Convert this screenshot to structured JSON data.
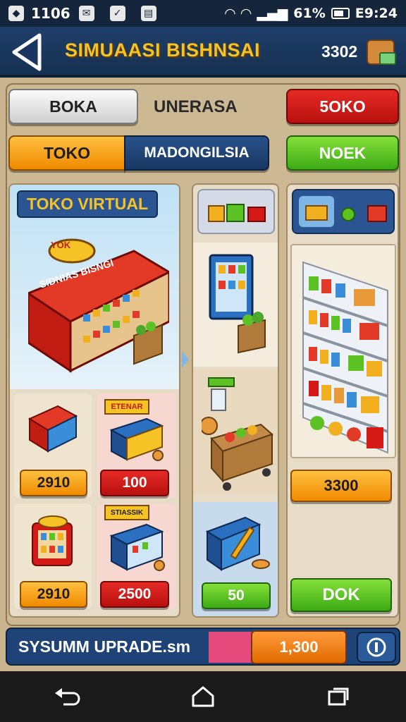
{
  "status_bar": {
    "left_text": "1106",
    "battery_percent": "61%",
    "time": "E9:24"
  },
  "header": {
    "title": "SIMUAASI BISHNSAI",
    "coins": "3302"
  },
  "tabs_row1": {
    "left": "BOKA",
    "middle": "UNERASA",
    "right": "5OKO"
  },
  "tabs_row2": {
    "left": "TOKO",
    "middle": "MADONGILSIA",
    "right": "NOEK"
  },
  "left_column": {
    "title": "TOKO VIRTUAL",
    "store_badge": "YOK",
    "store_sign": "SIDNIAS BISNGI",
    "cards": [
      {
        "sign": "",
        "price": "2910",
        "color": "orange"
      },
      {
        "sign": "ETENAR",
        "price": "100",
        "color": "red"
      },
      {
        "sign": "",
        "price": "2910",
        "color": "orange"
      },
      {
        "sign": "STIASSIK",
        "price": "2500",
        "color": "red"
      }
    ]
  },
  "middle_column": {
    "price": "50"
  },
  "right_column": {
    "price": "3300",
    "ok_label": "DOK"
  },
  "upgrade_bar": {
    "label": "SYSUMM UPRADE.sm",
    "price": "1,300"
  },
  "colors": {
    "header_bg": "#1f3f6b",
    "title_yellow": "#f5c325",
    "panel_bg": "#cdb894",
    "red": "#d41a17",
    "orange": "#f5a21c",
    "green": "#5cc224",
    "blue": "#1f4377"
  }
}
